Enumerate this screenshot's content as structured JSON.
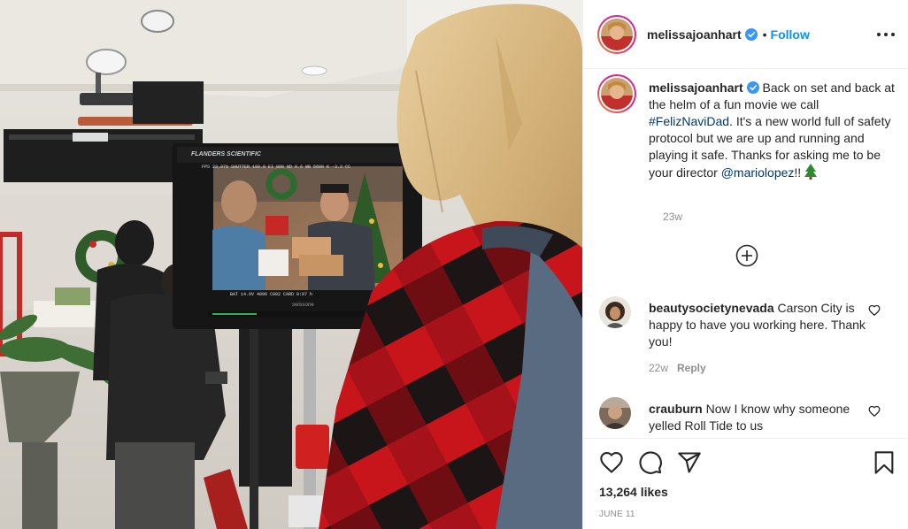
{
  "post": {
    "username": "melissajoanhart",
    "verified": true,
    "separator": "•",
    "follow_label": "Follow",
    "more_options_icon": "more-horizontal-icon"
  },
  "caption": {
    "username": "melissajoanhart",
    "text_part1": "Back on set and back at the helm of a fun movie we call",
    "hashtag": "#FelizNaviDad",
    "text_part2": ". It's a new world full of safety protocol but we are up and running and playing it safe. Thanks for asking me to be your director",
    "mention": "@mariolopez",
    "text_part3": "!!",
    "emoji_icon": "christmas-tree-icon",
    "time": "23w"
  },
  "load_more_icon": "plus-circle-icon",
  "comments": [
    {
      "username": "beautysocietynevada",
      "text": "Carson City is happy to have you working here. Thank you!",
      "time": "22w",
      "reply_label": "Reply"
    },
    {
      "username": "crauburn",
      "text": "Now I know why someone yelled Roll Tide to us",
      "time": "",
      "reply_label": ""
    }
  ],
  "actions": {
    "like_icon": "heart-icon",
    "comment_icon": "comment-icon",
    "share_icon": "paper-plane-icon",
    "save_icon": "bookmark-icon"
  },
  "likes": "13,264 likes",
  "date": "JUNE 11",
  "monitor": {
    "brand": "FLANDERS SCIENTIFIC",
    "top_readout": "FPS 23.976   SHUTTER 180.0       EI 800  ND 0.6   WB 5600 K  -3.2 CC",
    "bottom_readout": "BAT 14.9V      4096 C002             CARD          0:07 h",
    "maker": "swissone"
  },
  "colors": {
    "accent": "#0095f6",
    "link": "#00376b",
    "text": "#262626",
    "muted": "#8e8e8e",
    "border": "#efefef",
    "shirt_red": "#c8151b",
    "shirt_black": "#1c1515"
  }
}
